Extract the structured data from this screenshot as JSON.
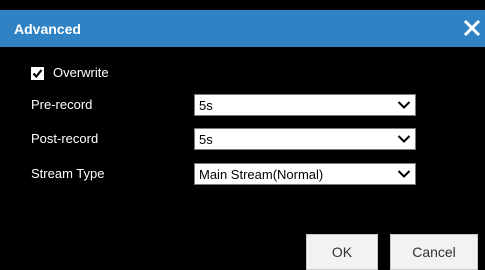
{
  "dialog": {
    "title": "Advanced",
    "close_icon": "close-icon",
    "accent_color": "#2f83c5"
  },
  "form": {
    "overwrite": {
      "label": "Overwrite",
      "checked": true
    },
    "pre_record": {
      "label": "Pre-record",
      "value": "5s"
    },
    "post_record": {
      "label": "Post-record",
      "value": "5s"
    },
    "stream_type": {
      "label": "Stream Type",
      "value": "Main Stream(Normal)"
    }
  },
  "buttons": {
    "ok_label": "OK",
    "cancel_label": "Cancel"
  }
}
